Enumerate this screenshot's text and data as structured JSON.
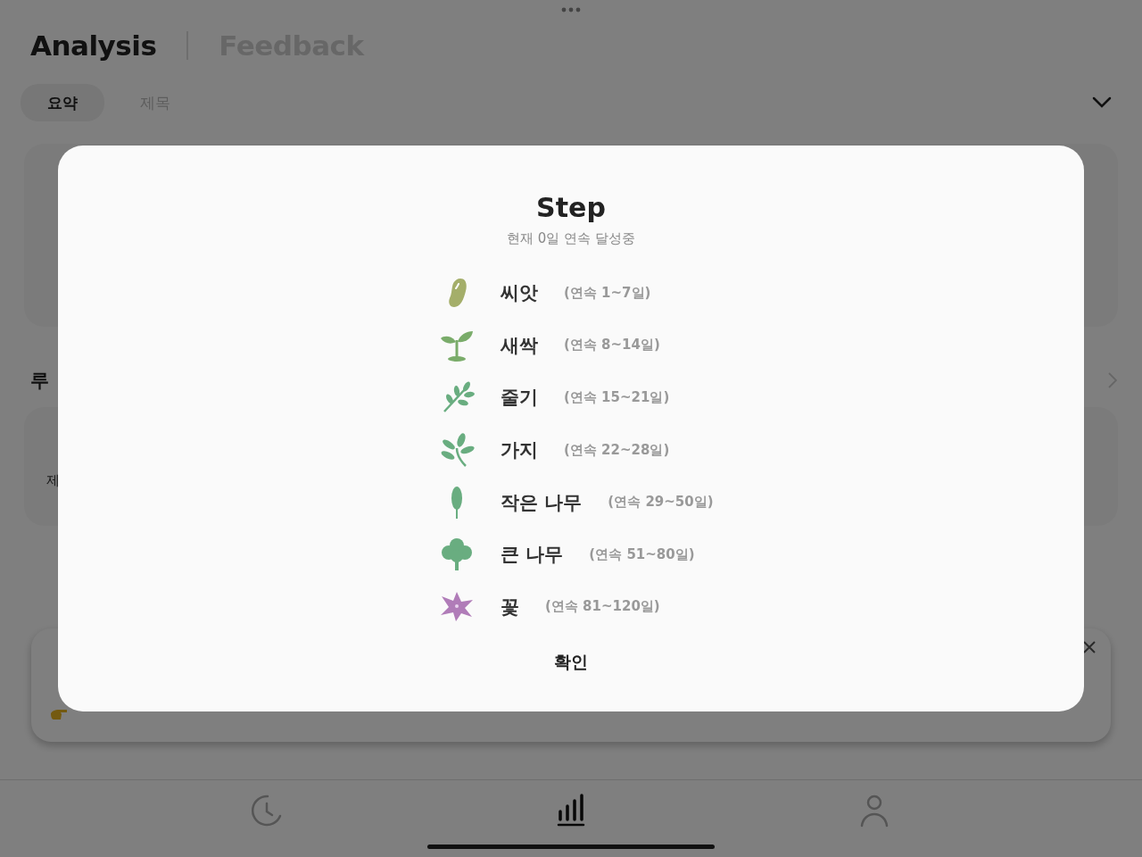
{
  "header": {
    "tabs": [
      {
        "label": "Analysis",
        "selected": true
      },
      {
        "label": "Feedback",
        "selected": false
      }
    ]
  },
  "sub_tabs": [
    {
      "label": "요약",
      "selected": true
    },
    {
      "label": "제목",
      "selected": false
    }
  ],
  "routine_section": {
    "title": "루",
    "card_text": "제"
  },
  "bottom_nav": [
    {
      "kind": "history",
      "selected": false
    },
    {
      "kind": "analysis",
      "selected": true
    },
    {
      "kind": "profile",
      "selected": false
    }
  ],
  "modal": {
    "title": "Step",
    "subtitle": "현재 0일 연속 달성중",
    "steps": [
      {
        "kind": "bean",
        "name": "씨앗",
        "range": "(연속 1~7일)"
      },
      {
        "kind": "sprout",
        "name": "새싹",
        "range": "(연속 8~14일)"
      },
      {
        "kind": "stem",
        "name": "줄기",
        "range": "(연속 15~21일)"
      },
      {
        "kind": "branch",
        "name": "가지",
        "range": "(연속 22~28일)"
      },
      {
        "kind": "sapling",
        "name": "작은 나무",
        "range": "(연속 29~50일)"
      },
      {
        "kind": "tree",
        "name": "큰 나무",
        "range": "(연속 51~80일)"
      },
      {
        "kind": "flower",
        "name": "꽃",
        "range": "(연속 81~120일)"
      }
    ],
    "confirm": "확인"
  }
}
